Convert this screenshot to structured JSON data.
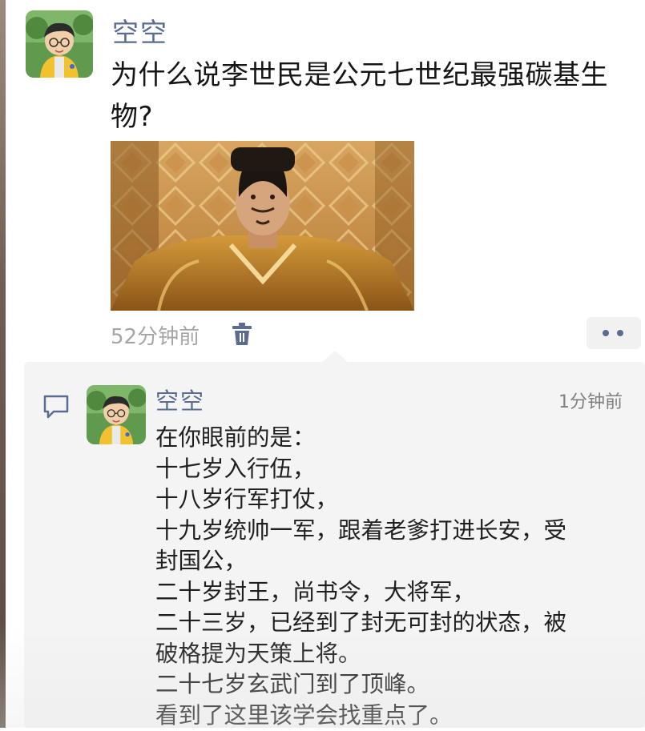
{
  "post": {
    "author": "空空",
    "text": "为什么说李世民是公元七世纪最强碳基生物?",
    "time": "52分钟前",
    "icons": {
      "delete": "trash-icon",
      "more": "more-dots-icon"
    }
  },
  "comment": {
    "icon": "comment-bubble-icon",
    "author": "空空",
    "time": "1分钟前",
    "lines": [
      "在你眼前的是：",
      "十七岁入行伍，",
      "十八岁行军打仗，",
      "十九岁统帅一军，跟着老爹打进长安，受",
      "封国公，",
      "二十岁封王，尚书令，大将军，",
      "二十三岁，已经到了封无可封的状态，被",
      "破格提为天策上将。",
      "二十七岁玄武门到了顶峰。",
      "看到了这里该学会找重点了。"
    ]
  },
  "colors": {
    "name_link": "#5a6c92",
    "time_gray": "#a5a5a5",
    "panel_bg": "#f4f4f4"
  }
}
